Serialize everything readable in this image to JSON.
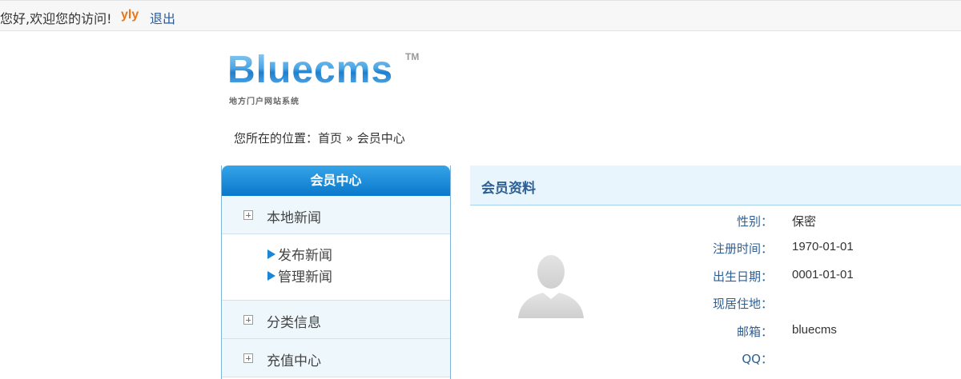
{
  "topbar": {
    "greeting": "您好,欢迎您的访问!",
    "username": "yly",
    "logout": "退出"
  },
  "logo": {
    "name": "Bluecms",
    "tm": "TM",
    "tagline": "地方门户网站系统"
  },
  "breadcrumb": {
    "prefix": "您所在的位置：",
    "home": "首页",
    "sep": "»",
    "current": "会员中心"
  },
  "sidebar": {
    "title": "会员中心",
    "sections": [
      {
        "label": "本地新闻",
        "items": [
          "发布新闻",
          "管理新闻"
        ]
      },
      {
        "label": "分类信息"
      },
      {
        "label": "充值中心"
      }
    ]
  },
  "panel": {
    "title": "会员资料",
    "fields": [
      {
        "label": "性别：",
        "value": "保密"
      },
      {
        "label": "注册时间：",
        "value": "1970-01-01"
      },
      {
        "label": "出生日期：",
        "value": "0001-01-01"
      },
      {
        "label": "现居住地：",
        "value": ""
      },
      {
        "label": "邮箱：",
        "value": "bluecms"
      },
      {
        "label": "QQ：",
        "value": ""
      }
    ]
  },
  "colors": {
    "accent": "#0a78cb",
    "label_blue": "#2c5f95",
    "username_orange": "#e8761a"
  }
}
